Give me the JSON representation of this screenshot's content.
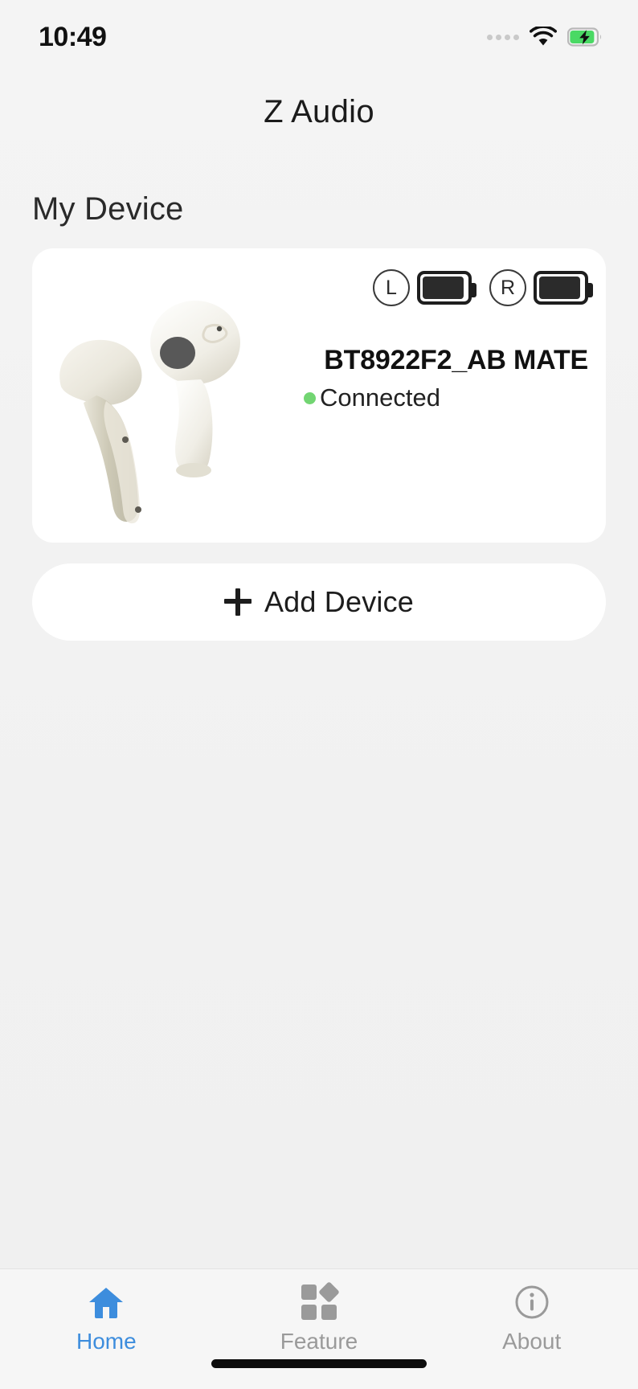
{
  "status_bar": {
    "time": "10:49",
    "signal_icon": "signal-dots-icon",
    "wifi_icon": "wifi-icon",
    "battery_icon": "battery-charging-icon",
    "battery_charging": true
  },
  "header": {
    "title": "Z Audio"
  },
  "main": {
    "section_title": "My Device",
    "device": {
      "name": "BT8922F2_AB MATE",
      "status_text": "Connected",
      "status_color": "#72d572",
      "left_label": "L",
      "right_label": "R",
      "left_battery_percent": 95,
      "right_battery_percent": 95,
      "product_image_alt": "wireless-earbuds"
    },
    "add_device": {
      "label": "Add Device",
      "icon": "plus-icon"
    }
  },
  "tabbar": {
    "items": [
      {
        "label": "Home",
        "icon": "home-icon",
        "active": true
      },
      {
        "label": "Feature",
        "icon": "grid-diamond-icon",
        "active": false
      },
      {
        "label": "About",
        "icon": "info-circle-icon",
        "active": false
      }
    ],
    "active_color": "#3d8ddd",
    "inactive_color": "#9a9a9a"
  }
}
